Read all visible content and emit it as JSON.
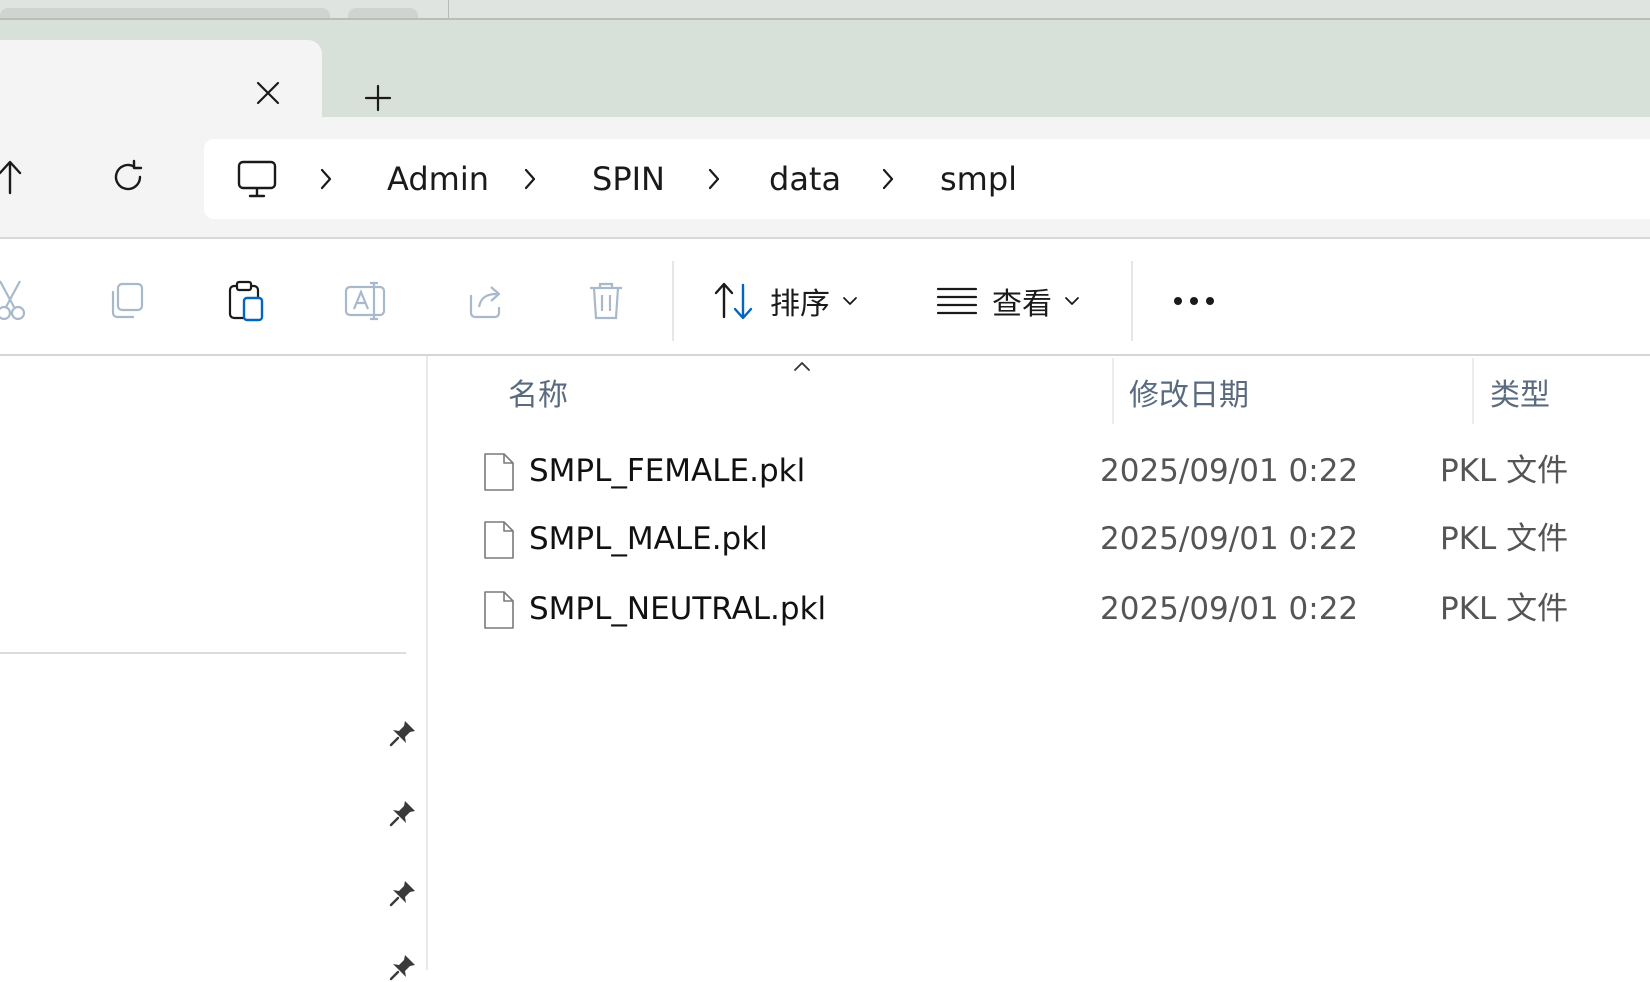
{
  "colors": {
    "tabbar_bg": "#d8e0da",
    "navbar_bg": "#f3f4f3",
    "accent_blue": "#0067c0",
    "icon_disabled": "#a9b9cc",
    "header_text": "#5a6b80"
  },
  "tabs": {
    "close_icon": "close-icon",
    "new_tab_icon": "plus-icon"
  },
  "nav": {
    "up_icon": "arrow-up-icon",
    "refresh_icon": "refresh-icon",
    "breadcrumb": [
      "Admin",
      "SPIN",
      "data",
      "smpl"
    ],
    "root_icon": "computer-icon"
  },
  "toolbar": {
    "icons": [
      "cut-icon",
      "copy-icon",
      "paste-icon",
      "rename-icon",
      "share-icon",
      "delete-icon"
    ],
    "sort_label": "排序",
    "view_label": "查看",
    "more_icon": "more-icon"
  },
  "columns": {
    "name": "名称",
    "modified": "修改日期",
    "type": "类型",
    "sort_direction": "ascending"
  },
  "files": [
    {
      "name": "SMPL_FEMALE.pkl",
      "modified": "2025/09/01 0:22",
      "type": "PKL 文件"
    },
    {
      "name": "SMPL_MALE.pkl",
      "modified": "2025/09/01 0:22",
      "type": "PKL 文件"
    },
    {
      "name": "SMPL_NEUTRAL.pkl",
      "modified": "2025/09/01 0:22",
      "type": "PKL 文件"
    }
  ]
}
